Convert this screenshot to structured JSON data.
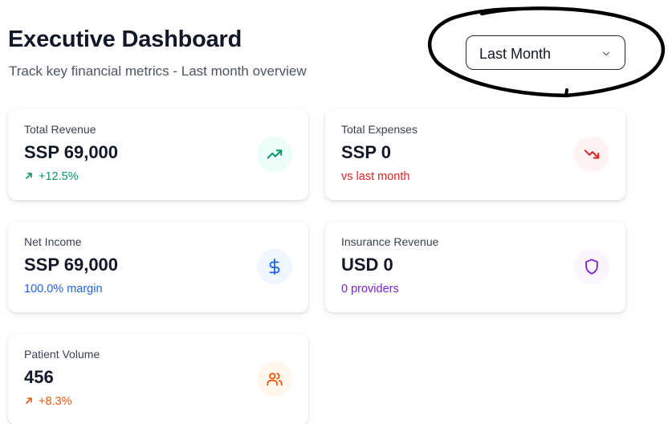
{
  "header": {
    "title": "Executive Dashboard",
    "subtitle": "Track key financial metrics - Last month overview"
  },
  "period_select": {
    "value": "Last Month"
  },
  "colors": {
    "green": "#059669",
    "red": "#dc2626",
    "blue": "#2563eb",
    "purple": "#7e22ce",
    "orange": "#ea580c"
  },
  "cards": [
    {
      "label": "Total Revenue",
      "value": "SSP 69,000",
      "sub": "+12.5%",
      "icon": "trending-up-icon"
    },
    {
      "label": "Total Expenses",
      "value": "SSP 0",
      "sub": "vs last month",
      "icon": "trending-down-icon"
    },
    {
      "label": "Net Income",
      "value": "SSP 69,000",
      "sub": "100.0% margin",
      "icon": "dollar-icon"
    },
    {
      "label": "Insurance Revenue",
      "value": "USD 0",
      "sub": "0 providers",
      "icon": "shield-icon"
    },
    {
      "label": "Patient Volume",
      "value": "456",
      "sub": "+8.3%",
      "icon": "users-icon"
    }
  ]
}
